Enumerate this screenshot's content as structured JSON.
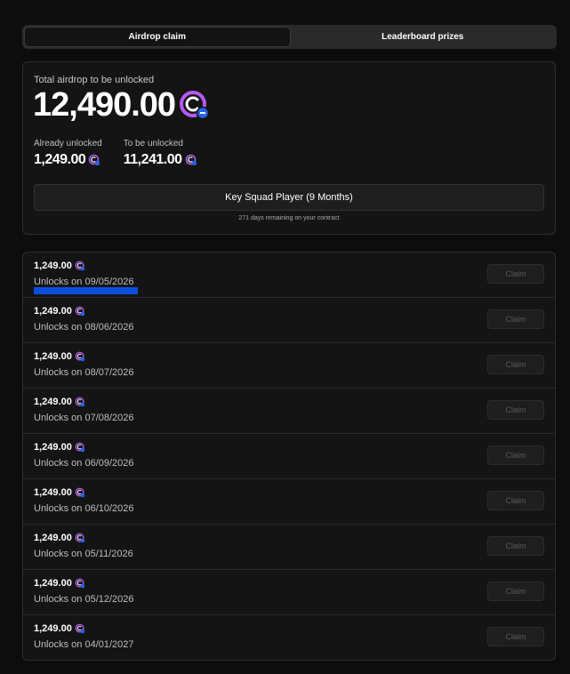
{
  "tabs": [
    {
      "label": "Airdrop claim",
      "active": true
    },
    {
      "label": "Leaderboard prizes",
      "active": false
    }
  ],
  "summary": {
    "total_label": "Total airdrop to be unlocked",
    "total_amount": "12,490.00",
    "already_label": "Already unlocked",
    "already_value": "1,249.00",
    "tobe_label": "To be unlocked",
    "tobe_value": "11,241.00",
    "player_label": "Key Squad Player (9 Months)",
    "remaining": "271 days remaining on your contract"
  },
  "colors": {
    "coin": "#b45af2",
    "badge": "#2563eb",
    "progress": "#0a4fe0"
  },
  "claim_label": "Claim",
  "unlocks": [
    {
      "amount": "1,249.00",
      "date": "Unlocks on 09/05/2026",
      "progress": 0.45
    },
    {
      "amount": "1,249.00",
      "date": "Unlocks on 08/06/2026"
    },
    {
      "amount": "1,249.00",
      "date": "Unlocks on 08/07/2026"
    },
    {
      "amount": "1,249.00",
      "date": "Unlocks on 07/08/2026"
    },
    {
      "amount": "1,249.00",
      "date": "Unlocks on 06/09/2026"
    },
    {
      "amount": "1,249.00",
      "date": "Unlocks on 06/10/2026"
    },
    {
      "amount": "1,249.00",
      "date": "Unlocks on 05/11/2026"
    },
    {
      "amount": "1,249.00",
      "date": "Unlocks on 05/12/2026"
    },
    {
      "amount": "1,249.00",
      "date": "Unlocks on 04/01/2027"
    }
  ]
}
